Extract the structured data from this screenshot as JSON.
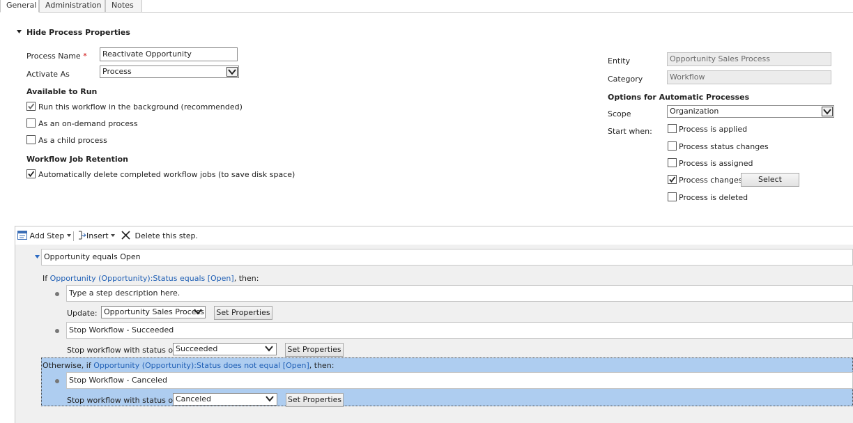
{
  "tabs": [
    {
      "label": "General",
      "active": true
    },
    {
      "label": "Administration",
      "active": false
    },
    {
      "label": "Notes",
      "active": false
    }
  ],
  "properties": {
    "toggle_label": "Hide Process Properties",
    "process_name_label": "Process Name",
    "required_mark": "*",
    "process_name_value": "Reactivate Opportunity",
    "activate_as_label": "Activate As",
    "activate_as_value": "Process",
    "available_heading": "Available to Run",
    "background_label": "Run this workflow in the background (recommended)",
    "background_checked": true,
    "on_demand_label": "As an on-demand process",
    "on_demand_checked": false,
    "child_label": "As a child process",
    "child_checked": false,
    "retention_heading": "Workflow Job Retention",
    "auto_delete_label": "Automatically delete completed workflow jobs (to save disk space)",
    "auto_delete_checked": true
  },
  "right_panel": {
    "entity_label": "Entity",
    "entity_value": "Opportunity Sales Process",
    "category_label": "Category",
    "category_value": "Workflow",
    "options_heading": "Options for Automatic Processes",
    "scope_label": "Scope",
    "scope_value": "Organization",
    "start_when_label": "Start when:",
    "triggers": [
      {
        "label": "Process is applied",
        "checked": false
      },
      {
        "label": "Process status changes",
        "checked": false
      },
      {
        "label": "Process is assigned",
        "checked": false
      },
      {
        "label": "Process changes",
        "checked": true
      },
      {
        "label": "Process is deleted",
        "checked": false
      }
    ],
    "select_button": "Select"
  },
  "toolbar": {
    "add_step": "Add Step",
    "insert": "Insert",
    "delete": "Delete this step."
  },
  "designer": {
    "condition_title": "Opportunity equals Open",
    "if_prefix": "If ",
    "if_link": "Opportunity (Opportunity):Status equals [Open]",
    "if_suffix": ", then:",
    "step1_description": "Type a step description here.",
    "update_label": "Update:",
    "update_value": "Opportunity Sales Process",
    "set_properties": "Set Properties",
    "step2_title": "Stop Workflow - Succeeded",
    "stop_status_label": "Stop workflow with status of:",
    "status_succeeded": "Succeeded",
    "otherwise_prefix": "Otherwise, if ",
    "otherwise_link": "Opportunity (Opportunity):Status does not equal [Open]",
    "otherwise_suffix": ", then:",
    "step3_title": "Stop Workflow - Canceled",
    "status_canceled": "Canceled"
  },
  "colors": {
    "link": "#1f5fb5",
    "selection": "#aecdf0",
    "required": "#cc0000"
  }
}
